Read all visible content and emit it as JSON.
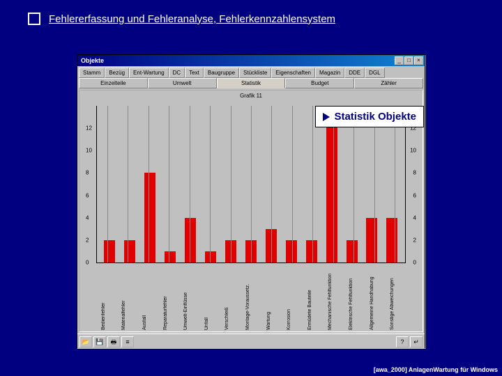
{
  "slide": {
    "title": "Fehlererfassung und Fehleranalyse, Fehlerkennzahlensystem"
  },
  "window": {
    "title": "Objekte",
    "min": "_",
    "max": "□",
    "close": "×"
  },
  "tabs_row1": [
    "Stamm",
    "Bezüg",
    "Ent-Wartung",
    "DC",
    "Text",
    "Baugruppe",
    "Stückliste",
    "Eigenschaften",
    "Magazin",
    "DDE",
    "DGL"
  ],
  "tabs_row2": [
    "Einzelteile",
    "Umwelt",
    "Statistik",
    "Budget",
    "Zähler"
  ],
  "callout": "Statistik Objekte",
  "toolbar": {
    "open": "📂",
    "save": "💾",
    "print": "🖶",
    "cfg": "≡",
    "help": "?",
    "exit": "↵"
  },
  "footer": "[awa_2000]  AnlagenWartung für Windows",
  "chart_data": {
    "type": "bar",
    "title": "Grafik 11",
    "ylabel": "",
    "xlabel": "",
    "ylim": [
      0,
      14
    ],
    "yticks": [
      0,
      2,
      4,
      6,
      8,
      10,
      12
    ],
    "categories": [
      "Bedienfehler",
      "Materialfehler",
      "Ausfall",
      "Reparaturfehler",
      "Umwelt-Einflüsse",
      "Unfall",
      "Verschleiß",
      "Montage-Voraussetz.",
      "Wartung",
      "Korrosion",
      "Ermüdete Bauteile",
      "Mechanische Fehlfunktion",
      "Elektrische Fehlfunktion",
      "Allgemeine Handhabung",
      "Sonstige Abweichungen"
    ],
    "values": [
      2,
      2,
      8,
      1,
      4,
      1,
      2,
      2,
      3,
      2,
      2,
      14,
      2,
      4,
      4
    ]
  }
}
